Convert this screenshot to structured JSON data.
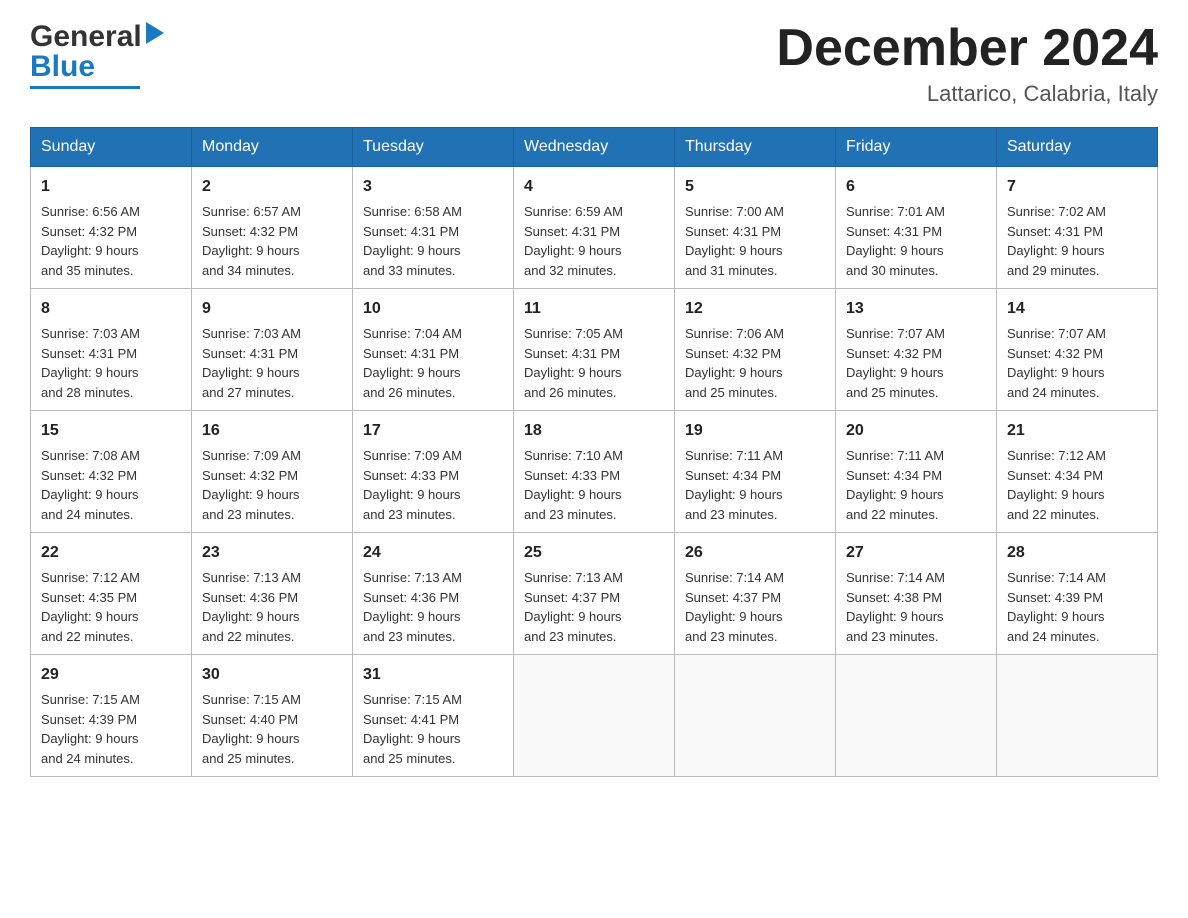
{
  "header": {
    "logo_general": "General",
    "logo_blue": "Blue",
    "month_title": "December 2024",
    "location": "Lattarico, Calabria, Italy"
  },
  "weekdays": [
    "Sunday",
    "Monday",
    "Tuesday",
    "Wednesday",
    "Thursday",
    "Friday",
    "Saturday"
  ],
  "weeks": [
    [
      {
        "day": "1",
        "info": "Sunrise: 6:56 AM\nSunset: 4:32 PM\nDaylight: 9 hours\nand 35 minutes."
      },
      {
        "day": "2",
        "info": "Sunrise: 6:57 AM\nSunset: 4:32 PM\nDaylight: 9 hours\nand 34 minutes."
      },
      {
        "day": "3",
        "info": "Sunrise: 6:58 AM\nSunset: 4:31 PM\nDaylight: 9 hours\nand 33 minutes."
      },
      {
        "day": "4",
        "info": "Sunrise: 6:59 AM\nSunset: 4:31 PM\nDaylight: 9 hours\nand 32 minutes."
      },
      {
        "day": "5",
        "info": "Sunrise: 7:00 AM\nSunset: 4:31 PM\nDaylight: 9 hours\nand 31 minutes."
      },
      {
        "day": "6",
        "info": "Sunrise: 7:01 AM\nSunset: 4:31 PM\nDaylight: 9 hours\nand 30 minutes."
      },
      {
        "day": "7",
        "info": "Sunrise: 7:02 AM\nSunset: 4:31 PM\nDaylight: 9 hours\nand 29 minutes."
      }
    ],
    [
      {
        "day": "8",
        "info": "Sunrise: 7:03 AM\nSunset: 4:31 PM\nDaylight: 9 hours\nand 28 minutes."
      },
      {
        "day": "9",
        "info": "Sunrise: 7:03 AM\nSunset: 4:31 PM\nDaylight: 9 hours\nand 27 minutes."
      },
      {
        "day": "10",
        "info": "Sunrise: 7:04 AM\nSunset: 4:31 PM\nDaylight: 9 hours\nand 26 minutes."
      },
      {
        "day": "11",
        "info": "Sunrise: 7:05 AM\nSunset: 4:31 PM\nDaylight: 9 hours\nand 26 minutes."
      },
      {
        "day": "12",
        "info": "Sunrise: 7:06 AM\nSunset: 4:32 PM\nDaylight: 9 hours\nand 25 minutes."
      },
      {
        "day": "13",
        "info": "Sunrise: 7:07 AM\nSunset: 4:32 PM\nDaylight: 9 hours\nand 25 minutes."
      },
      {
        "day": "14",
        "info": "Sunrise: 7:07 AM\nSunset: 4:32 PM\nDaylight: 9 hours\nand 24 minutes."
      }
    ],
    [
      {
        "day": "15",
        "info": "Sunrise: 7:08 AM\nSunset: 4:32 PM\nDaylight: 9 hours\nand 24 minutes."
      },
      {
        "day": "16",
        "info": "Sunrise: 7:09 AM\nSunset: 4:32 PM\nDaylight: 9 hours\nand 23 minutes."
      },
      {
        "day": "17",
        "info": "Sunrise: 7:09 AM\nSunset: 4:33 PM\nDaylight: 9 hours\nand 23 minutes."
      },
      {
        "day": "18",
        "info": "Sunrise: 7:10 AM\nSunset: 4:33 PM\nDaylight: 9 hours\nand 23 minutes."
      },
      {
        "day": "19",
        "info": "Sunrise: 7:11 AM\nSunset: 4:34 PM\nDaylight: 9 hours\nand 23 minutes."
      },
      {
        "day": "20",
        "info": "Sunrise: 7:11 AM\nSunset: 4:34 PM\nDaylight: 9 hours\nand 22 minutes."
      },
      {
        "day": "21",
        "info": "Sunrise: 7:12 AM\nSunset: 4:34 PM\nDaylight: 9 hours\nand 22 minutes."
      }
    ],
    [
      {
        "day": "22",
        "info": "Sunrise: 7:12 AM\nSunset: 4:35 PM\nDaylight: 9 hours\nand 22 minutes."
      },
      {
        "day": "23",
        "info": "Sunrise: 7:13 AM\nSunset: 4:36 PM\nDaylight: 9 hours\nand 22 minutes."
      },
      {
        "day": "24",
        "info": "Sunrise: 7:13 AM\nSunset: 4:36 PM\nDaylight: 9 hours\nand 23 minutes."
      },
      {
        "day": "25",
        "info": "Sunrise: 7:13 AM\nSunset: 4:37 PM\nDaylight: 9 hours\nand 23 minutes."
      },
      {
        "day": "26",
        "info": "Sunrise: 7:14 AM\nSunset: 4:37 PM\nDaylight: 9 hours\nand 23 minutes."
      },
      {
        "day": "27",
        "info": "Sunrise: 7:14 AM\nSunset: 4:38 PM\nDaylight: 9 hours\nand 23 minutes."
      },
      {
        "day": "28",
        "info": "Sunrise: 7:14 AM\nSunset: 4:39 PM\nDaylight: 9 hours\nand 24 minutes."
      }
    ],
    [
      {
        "day": "29",
        "info": "Sunrise: 7:15 AM\nSunset: 4:39 PM\nDaylight: 9 hours\nand 24 minutes."
      },
      {
        "day": "30",
        "info": "Sunrise: 7:15 AM\nSunset: 4:40 PM\nDaylight: 9 hours\nand 25 minutes."
      },
      {
        "day": "31",
        "info": "Sunrise: 7:15 AM\nSunset: 4:41 PM\nDaylight: 9 hours\nand 25 minutes."
      },
      null,
      null,
      null,
      null
    ]
  ]
}
